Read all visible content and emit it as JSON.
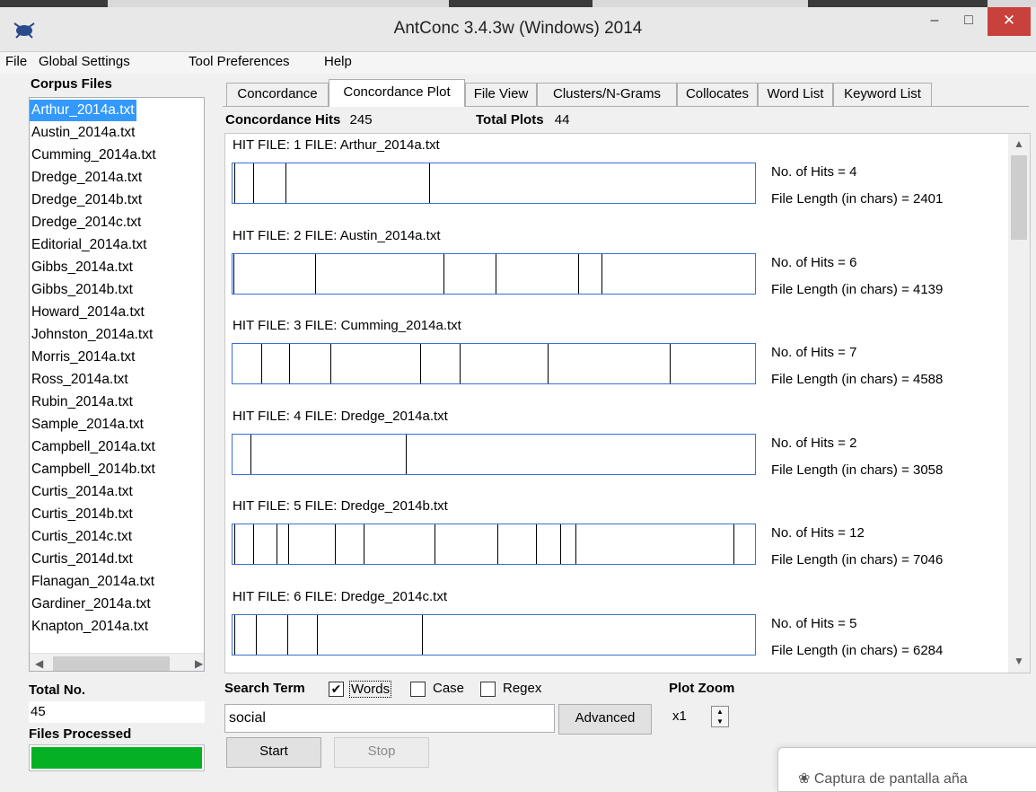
{
  "window": {
    "title": "AntConc 3.4.3w (Windows) 2014",
    "minimize_glyph": "–",
    "maximize_glyph": "□",
    "close_glyph": "✕",
    "app_icon": "antconc-app-icon"
  },
  "menu": {
    "items": [
      "File",
      "Global Settings",
      "Tool Preferences",
      "Help"
    ]
  },
  "sidebar": {
    "corpus_files_label": "Corpus Files",
    "files": [
      "Arthur_2014a.txt",
      "Austin_2014a.txt",
      "Cumming_2014a.txt",
      "Dredge_2014a.txt",
      "Dredge_2014b.txt",
      "Dredge_2014c.txt",
      "Editorial_2014a.txt",
      "Gibbs_2014a.txt",
      "Gibbs_2014b.txt",
      "Howard_2014a.txt",
      "Johnston_2014a.txt",
      "Morris_2014a.txt",
      "Ross_2014a.txt",
      "Rubin_2014a.txt",
      "Sample_2014a.txt",
      "Campbell_2014a.txt",
      "Campbell_2014b.txt",
      "Curtis_2014a.txt",
      "Curtis_2014b.txt",
      "Curtis_2014c.txt",
      "Curtis_2014d.txt",
      "Flanagan_2014a.txt",
      "Gardiner_2014a.txt",
      "Knapton_2014a.txt"
    ],
    "selected_file": "Arthur_2014a.txt",
    "total_no_label": "Total No.",
    "total_no_value": "45",
    "files_processed_label": "Files Processed",
    "files_processed_fraction": 1.0
  },
  "tabs": {
    "items": [
      "Concordance",
      "Concordance Plot",
      "File View",
      "Clusters/N-Grams",
      "Collocates",
      "Word List",
      "Keyword List"
    ],
    "active": "Concordance Plot"
  },
  "summary": {
    "concordance_hits_label": "Concordance Hits",
    "concordance_hits_value": "245",
    "total_plots_label": "Total Plots",
    "total_plots_value": "44"
  },
  "plots": [
    {
      "header": "HIT FILE: 1   FILE: Arthur_2014a.txt",
      "hits_text": "No. of Hits = 4",
      "length_text": "File Length (in chars) = 2401",
      "hit_positions": [
        0.004,
        0.04,
        0.102,
        0.377
      ]
    },
    {
      "header": "HIT FILE: 2   FILE: Austin_2014a.txt",
      "hits_text": "No. of Hits = 6",
      "length_text": "File Length (in chars) = 4139",
      "hit_positions": [
        0.002,
        0.158,
        0.403,
        0.504,
        0.661,
        0.706
      ]
    },
    {
      "header": "HIT FILE: 3   FILE: Cumming_2014a.txt",
      "hits_text": "No. of Hits = 7",
      "length_text": "File Length (in chars) = 4588",
      "hit_positions": [
        0.055,
        0.109,
        0.188,
        0.359,
        0.434,
        0.603,
        0.837
      ]
    },
    {
      "header": "HIT FILE: 4   FILE: Dredge_2014a.txt",
      "hits_text": "No. of Hits = 2",
      "length_text": "File Length (in chars) = 3058",
      "hit_positions": [
        0.034,
        0.332
      ]
    },
    {
      "header": "HIT FILE: 5   FILE: Dredge_2014b.txt",
      "hits_text": "No. of Hits = 12",
      "length_text": "File Length (in chars) = 7046",
      "hit_positions": [
        0.004,
        0.04,
        0.084,
        0.106,
        0.196,
        0.251,
        0.386,
        0.507,
        0.58,
        0.627,
        0.656,
        0.958
      ]
    },
    {
      "header": "HIT FILE: 6   FILE: Dredge_2014c.txt",
      "hits_text": "No. of Hits = 5",
      "length_text": "File Length (in chars) = 6284",
      "hit_positions": [
        0.004,
        0.044,
        0.104,
        0.161,
        0.362
      ]
    }
  ],
  "search": {
    "label": "Search Term",
    "words_label": "Words",
    "words_checked": true,
    "case_label": "Case",
    "case_checked": false,
    "regex_label": "Regex",
    "regex_checked": false,
    "value": "social",
    "advanced_label": "Advanced",
    "start_label": "Start",
    "stop_label": "Stop"
  },
  "plot_zoom": {
    "label": "Plot Zoom",
    "value": "x1"
  },
  "notification": {
    "text": "Captura de pantalla aña"
  }
}
